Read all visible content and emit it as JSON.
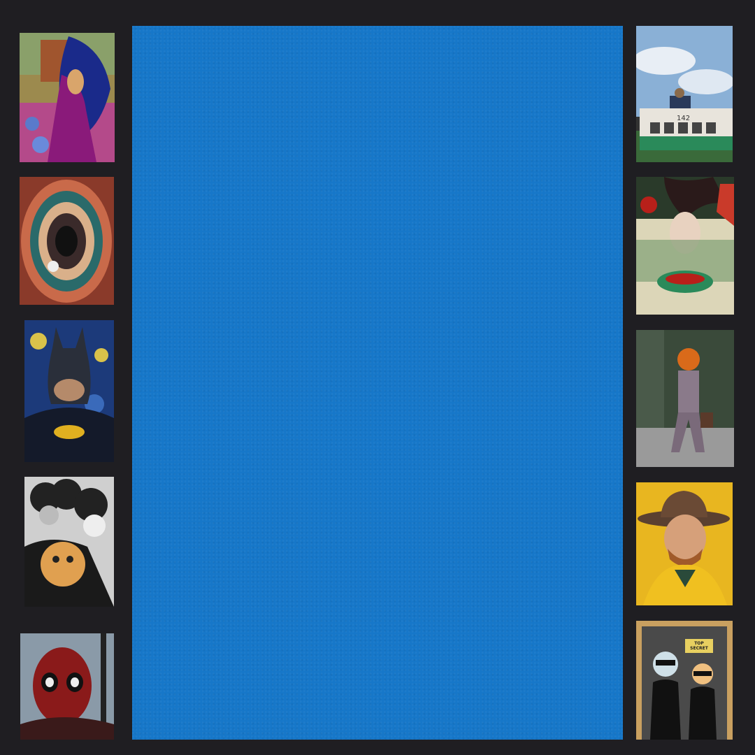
{
  "canvas": {
    "background": "#1f1e22"
  },
  "main_panel": {
    "color": "#1677c9"
  },
  "left_column": [
    {
      "subject": "woman-with-blue-hair-artwork"
    },
    {
      "subject": "psychedelic-eye-artwork"
    },
    {
      "subject": "batman-starry-night-artwork"
    },
    {
      "subject": "hooded-cats-photo"
    },
    {
      "subject": "deadpool-photo"
    }
  ],
  "right_column": [
    {
      "subject": "man-on-bus-142-photo",
      "text": "142"
    },
    {
      "subject": "figure-with-teacup-artwork"
    },
    {
      "subject": "pumpkin-head-man-walking-photo"
    },
    {
      "subject": "man-in-hat-yellow-coat-artwork"
    },
    {
      "subject": "agents-in-suits-cartoon",
      "text": "TOP SECRET"
    }
  ]
}
